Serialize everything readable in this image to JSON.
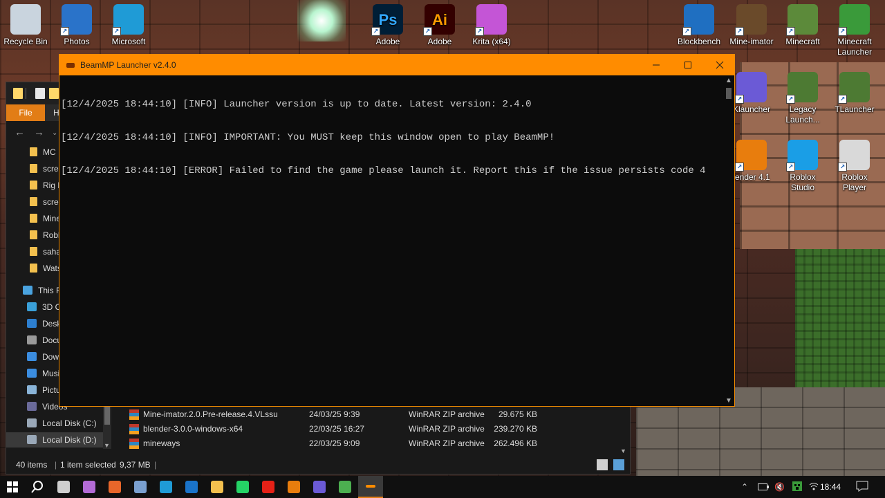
{
  "desktop": {
    "icons": [
      {
        "label": "Recycle Bin",
        "icon": "recycle-bin-icon",
        "color": "#c9d4de"
      },
      {
        "label": "Photos",
        "icon": "photos-icon",
        "color": "#2a73c9"
      },
      {
        "label": "Microsoft",
        "icon": "edge-icon",
        "color": "#1f9bd6"
      },
      {
        "label": "Adobe",
        "icon": "photoshop-icon",
        "glyph": "Ps",
        "color": "#001e36"
      },
      {
        "label": "Adobe",
        "icon": "illustrator-icon",
        "glyph": "Ai",
        "color": "#330000"
      },
      {
        "label": "Krita (x64)",
        "icon": "krita-icon",
        "color": "#c455d6"
      },
      {
        "label": "Blockbench",
        "icon": "blockbench-icon",
        "color": "#1f6fc1"
      },
      {
        "label": "Mine-imator",
        "icon": "mine-imator-icon",
        "color": "#6a4a2a"
      },
      {
        "label": "Minecraft",
        "icon": "minecraft-icon",
        "color": "#5c8a3a"
      },
      {
        "label": "Minecraft Launcher",
        "icon": "minecraft-launcher-icon",
        "color": "#3a9a3a"
      },
      {
        "label": "Klauncher",
        "icon": "klauncher-icon",
        "color": "#6b5ad6"
      },
      {
        "label": "Legacy Launch...",
        "icon": "legacy-launcher-icon",
        "color": "#4d7a33"
      },
      {
        "label": "TLauncher",
        "icon": "tlauncher-icon",
        "color": "#4d7a33"
      },
      {
        "label": "lender 4.1",
        "icon": "blender-icon",
        "color": "#e87d0d"
      },
      {
        "label": "Roblox Studio",
        "icon": "roblox-studio-icon",
        "color": "#1a9ee6"
      },
      {
        "label": "Roblox Player",
        "icon": "roblox-player-icon",
        "color": "#d9d9d9"
      }
    ]
  },
  "console": {
    "title": "BeamMP Launcher v2.4.0",
    "lines": [
      "[12/4/2025 18:44:10] [INFO] Launcher version is up to date. Latest version: 2.4.0",
      "[12/4/2025 18:44:10] [INFO] IMPORTANT: You MUST keep this window open to play BeamMP!",
      "[12/4/2025 18:44:10] [ERROR] Failed to find the game please launch it. Report this if the issue persists code 4"
    ],
    "accent": "#ff8c00"
  },
  "explorer": {
    "file_tab": "File",
    "home_tab": "H",
    "tree": [
      {
        "label": "MC",
        "type": "folder"
      },
      {
        "label": "scree",
        "type": "folder"
      },
      {
        "label": "Rig M",
        "type": "folder"
      },
      {
        "label": "scree",
        "type": "folder"
      },
      {
        "label": "Mine",
        "type": "folder"
      },
      {
        "label": "Robl",
        "type": "folder"
      },
      {
        "label": "saha",
        "type": "folder"
      },
      {
        "label": "Wats",
        "type": "folder"
      },
      {
        "label": "This P",
        "type": "pc",
        "color": "#4aa3df"
      },
      {
        "label": "3D O",
        "type": "sys",
        "color": "#3aa0d8"
      },
      {
        "label": "Desk",
        "type": "sys",
        "color": "#2d7fd0"
      },
      {
        "label": "Docu",
        "type": "sys",
        "color": "#9a9a9a"
      },
      {
        "label": "Dow",
        "type": "sys",
        "color": "#3b8de0"
      },
      {
        "label": "Musi",
        "type": "sys",
        "color": "#3b8de0"
      },
      {
        "label": "Pictu",
        "type": "sys",
        "color": "#8ab4d8"
      },
      {
        "label": "Videos",
        "type": "sys",
        "color": "#6a6a9a"
      },
      {
        "label": "Local Disk (C:)",
        "type": "disk",
        "color": "#9aa8b8"
      },
      {
        "label": "Local Disk (D:)",
        "type": "disk",
        "color": "#9aa8b8"
      }
    ],
    "files": [
      {
        "name": "Mine-imator.2.0.Pre-release.4.VLssu",
        "date": "24/03/25 9:39",
        "type": "WinRAR ZIP archive",
        "size": "29.675 KB"
      },
      {
        "name": "blender-3.0.0-windows-x64",
        "date": "22/03/25 16:27",
        "type": "WinRAR ZIP archive",
        "size": "239.270 KB"
      },
      {
        "name": "mineways",
        "date": "22/03/25 9:09",
        "type": "WinRAR ZIP archive",
        "size": "262.496 KB"
      }
    ],
    "status": {
      "items": "40 items",
      "selected": "1 item selected",
      "size": "9,37 MB",
      "sep": "|"
    }
  },
  "taskbar": {
    "apps": [
      {
        "icon": "task-view-icon",
        "color": "#cfcfcf"
      },
      {
        "icon": "copilot-icon",
        "color": "#b36bd6"
      },
      {
        "icon": "firefox-icon",
        "color": "#e8662a"
      },
      {
        "icon": "krita-taskbar-icon",
        "color": "#7aa0d0"
      },
      {
        "icon": "edge-taskbar-icon",
        "color": "#1f9bd6"
      },
      {
        "icon": "outlook-icon",
        "color": "#1a73c9"
      },
      {
        "icon": "file-explorer-icon",
        "color": "#f3c04e"
      },
      {
        "icon": "whatsapp-icon",
        "color": "#25d366"
      },
      {
        "icon": "youtube-icon",
        "color": "#e62117"
      },
      {
        "icon": "blender-taskbar-icon",
        "color": "#e87d0d"
      },
      {
        "icon": "klauncher-taskbar-icon",
        "color": "#6b5ad6"
      },
      {
        "icon": "chrome-icon",
        "color": "#4caf50"
      },
      {
        "icon": "beammp-taskbar-icon",
        "color": "#ff8c00"
      }
    ],
    "time": "18:44"
  }
}
